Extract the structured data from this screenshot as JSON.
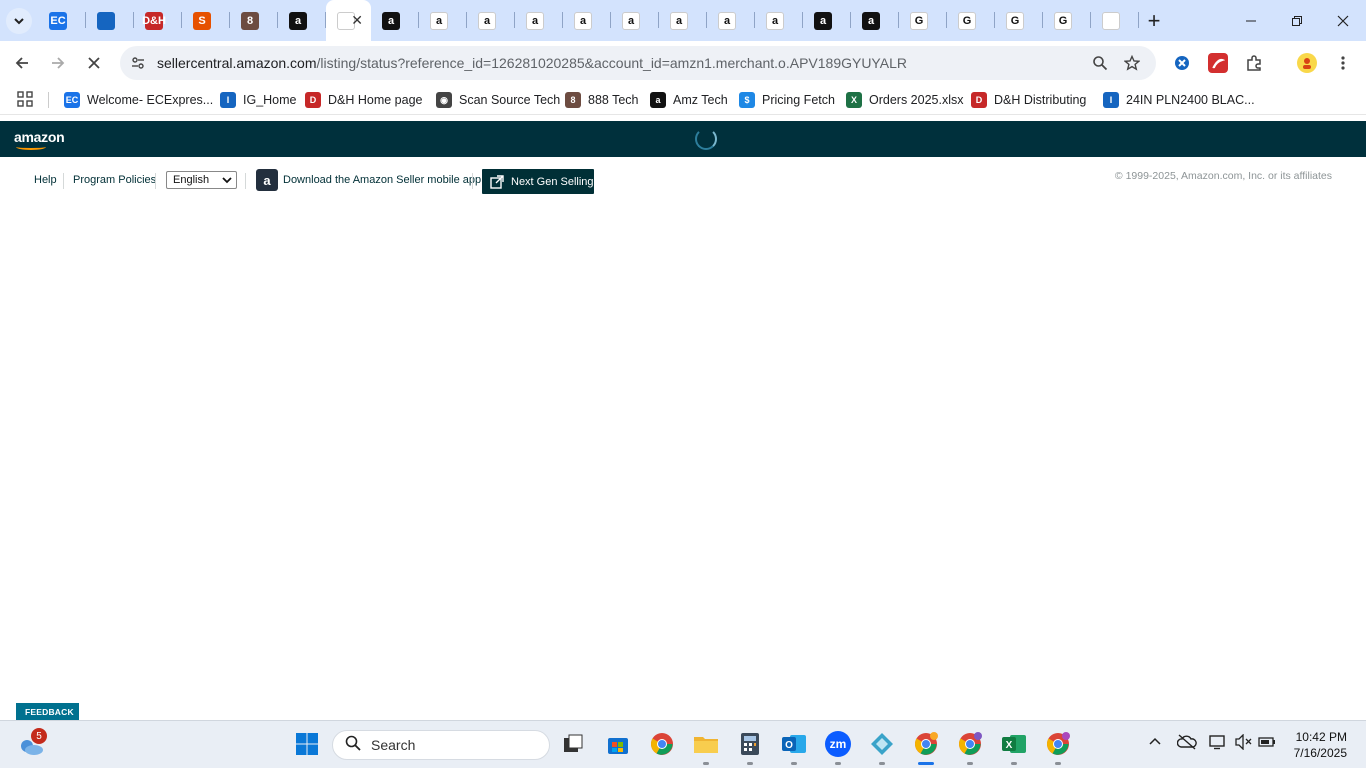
{
  "browser": {
    "tabs": [
      {
        "icon": "ecexpress-icon",
        "label": "EC",
        "color": "#1a73e8"
      },
      {
        "icon": "ingram-icon",
        "label": "",
        "color": "#1565c0"
      },
      {
        "icon": "dh-icon",
        "label": "D&H",
        "color": "#c62828"
      },
      {
        "icon": "scansource-icon",
        "label": "S",
        "color": "#e65100"
      },
      {
        "icon": "888-icon",
        "label": "8",
        "color": "#6d4c41"
      },
      {
        "icon": "amazon-icon",
        "label": "a",
        "color": "#111111"
      },
      {
        "icon": "active-tab-icon",
        "label": "",
        "color": "#ffffff"
      },
      {
        "icon": "amazon-icon",
        "label": "a",
        "color": "#111111"
      },
      {
        "icon": "amazon-smile-icon",
        "label": "a",
        "color": "#ffffff"
      },
      {
        "icon": "amazon-smile-icon",
        "label": "a",
        "color": "#ffffff"
      },
      {
        "icon": "amazon-smile-icon",
        "label": "a",
        "color": "#ffffff"
      },
      {
        "icon": "amazon-smile-icon",
        "label": "a",
        "color": "#ffffff"
      },
      {
        "icon": "amazon-smile-icon",
        "label": "a",
        "color": "#ffffff"
      },
      {
        "icon": "amazon-smile-icon",
        "label": "a",
        "color": "#ffffff"
      },
      {
        "icon": "amazon-smile-icon",
        "label": "a",
        "color": "#ffffff"
      },
      {
        "icon": "amazon-smile-icon",
        "label": "a",
        "color": "#ffffff"
      },
      {
        "icon": "amazon-icon",
        "label": "a",
        "color": "#111111"
      },
      {
        "icon": "amazon-icon",
        "label": "a",
        "color": "#111111"
      },
      {
        "icon": "google-icon",
        "label": "G",
        "color": "#ffffff"
      },
      {
        "icon": "google-icon",
        "label": "G",
        "color": "#ffffff"
      },
      {
        "icon": "google-icon",
        "label": "G",
        "color": "#ffffff"
      },
      {
        "icon": "google-icon",
        "label": "G",
        "color": "#ffffff"
      },
      {
        "icon": "chrome-icon",
        "label": "",
        "color": "#ffffff"
      }
    ],
    "url_host": "sellercentral.amazon.com",
    "url_path": "/listing/status?reference_id=126281020285&account_id=amzn1.merchant.o.APV189GYUYALR",
    "bookmarks": [
      {
        "label": "Welcome- ECExpres...",
        "icon": "ecexpress-icon",
        "color": "#1a73e8",
        "glyph": "EC"
      },
      {
        "label": "IG_Home",
        "icon": "ingram-icon",
        "color": "#1565c0",
        "glyph": "I"
      },
      {
        "label": "D&H Home page",
        "icon": "dh-icon",
        "color": "#c62828",
        "glyph": "D"
      },
      {
        "label": "Scan Source Tech",
        "icon": "globe-icon",
        "color": "#444444",
        "glyph": "◉"
      },
      {
        "label": "888 Tech",
        "icon": "888-icon",
        "color": "#6d4c41",
        "glyph": "8"
      },
      {
        "label": "Amz Tech",
        "icon": "amazon-icon",
        "color": "#111111",
        "glyph": "a"
      },
      {
        "label": "Pricing Fetch",
        "icon": "dollar-icon",
        "color": "#1e88e5",
        "glyph": "$"
      },
      {
        "label": "Orders 2025.xlsx",
        "icon": "excel-icon",
        "color": "#1e7145",
        "glyph": "X"
      },
      {
        "label": "D&H Distributing",
        "icon": "dh-icon",
        "color": "#c62828",
        "glyph": "D"
      },
      {
        "label": "24IN PLN2400 BLAC...",
        "icon": "ingram-icon",
        "color": "#1565c0",
        "glyph": "I"
      }
    ]
  },
  "seller_central": {
    "logo": "amazon",
    "links": {
      "help": "Help",
      "program_policies": "Program Policies",
      "language": "English",
      "download_app": "Download the Amazon Seller mobile app",
      "next_gen": "Next Gen Selling"
    },
    "copyright": "© 1999-2025, Amazon.com, Inc. or its affiliates",
    "feedback": "FEEDBACK"
  },
  "taskbar": {
    "search_placeholder": "Search",
    "weather_badge": "5",
    "time": "10:42 PM",
    "date": "7/16/2025"
  },
  "colors": {
    "header_bg": "#00303c",
    "tabstrip_bg": "#d3e3fd",
    "feedback_bg": "#00718f"
  }
}
